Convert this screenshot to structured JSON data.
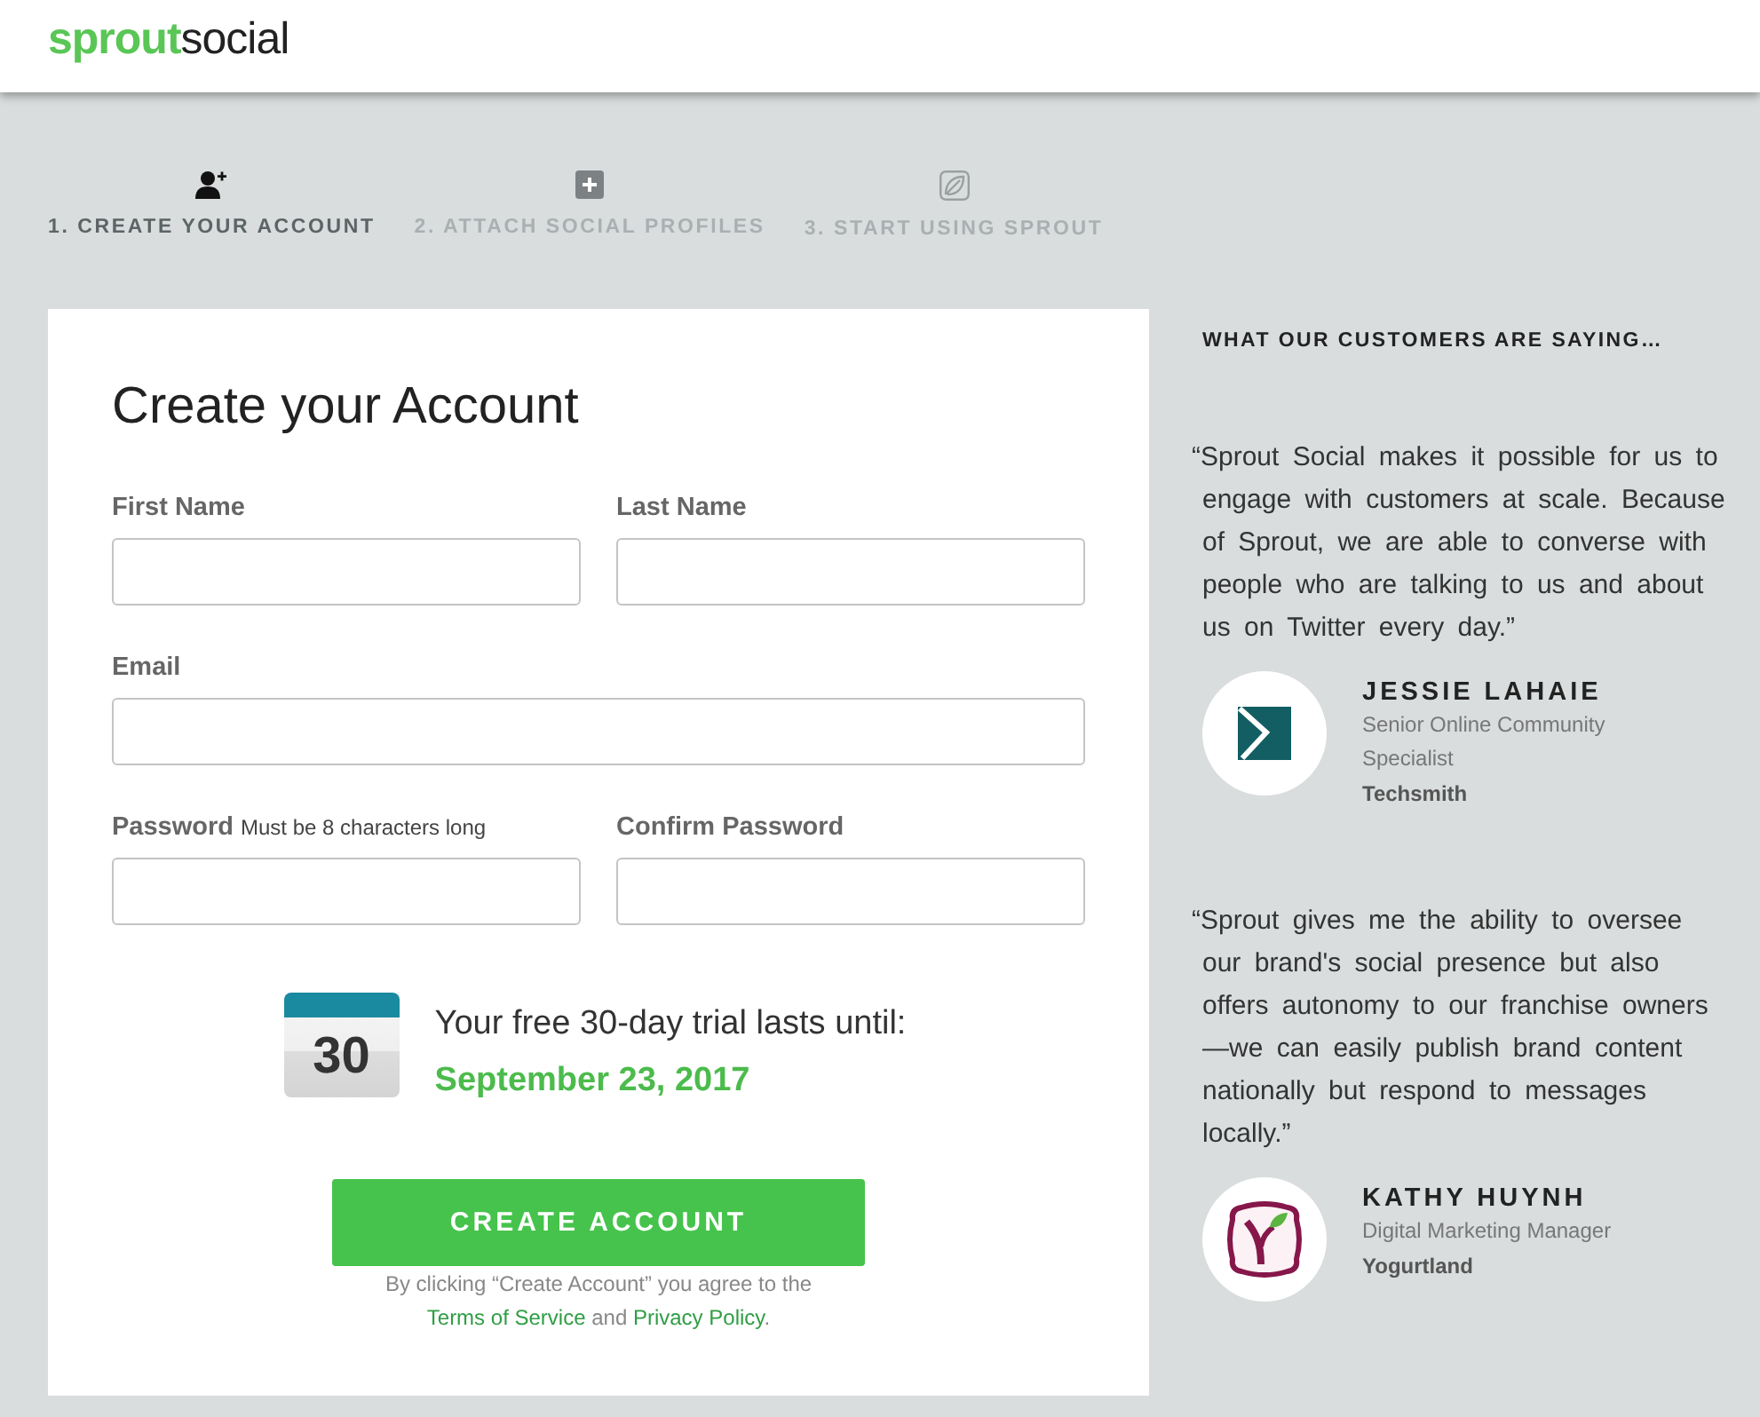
{
  "logo": {
    "accent": "sprout",
    "rest": "social"
  },
  "steps": [
    {
      "label": "1. CREATE YOUR ACCOUNT",
      "selected": true
    },
    {
      "label": "2. ATTACH SOCIAL PROFILES",
      "selected": false
    },
    {
      "label": "3. START USING SPROUT",
      "selected": false
    }
  ],
  "form": {
    "title": "Create your Account",
    "field_rows": [
      [
        {
          "label": "First Name"
        },
        {
          "label": "Last Name"
        }
      ],
      [
        {
          "label": "Email"
        }
      ],
      [
        {
          "label": "Password",
          "hint": "Must be 8 characters long"
        },
        {
          "label": "Confirm Password"
        }
      ]
    ],
    "trial": {
      "day": "30",
      "text": "Your free 30-day trial lasts until:",
      "date": "September 23, 2017"
    },
    "submit": "CREATE ACCOUNT",
    "legal": {
      "text": "By clicking “Create Account” you agree to the",
      "links": [
        "Terms of Service",
        "Privacy Policy"
      ],
      "joiner": "and",
      "end": "."
    }
  },
  "testimonials": {
    "heading": "WHAT OUR CUSTOMERS ARE SAYING…",
    "items": [
      {
        "quote": "“Sprout Social makes it possible for us to engage with customers at scale. Because of Sprout, we are able to converse with people who are talking to us and about us on Twitter every day.”",
        "name": "JESSIE LAHAIE",
        "role": "Senior Online Community Specialist",
        "company": "Techsmith"
      },
      {
        "quote": "“Sprout gives me the ability to oversee our brand's social presence but also offers autonomy to our franchise owners—we can easily publish brand content nationally but respond to messages locally.”",
        "name": "KATHY HUYNH",
        "role": "Digital Marketing Manager",
        "company": "Yogurtland"
      }
    ]
  }
}
